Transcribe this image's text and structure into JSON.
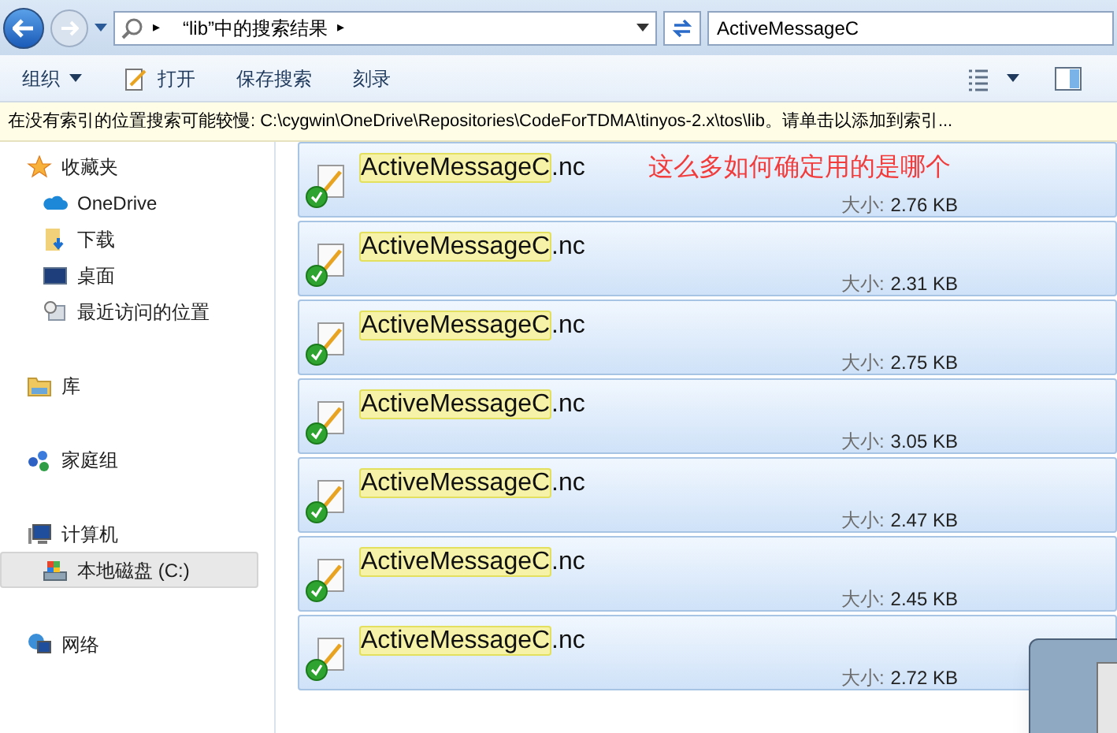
{
  "address": {
    "path": "“lib”中的搜索结果",
    "sep": "▸"
  },
  "search": {
    "value": "ActiveMessageC"
  },
  "toolbar": [
    {
      "label": "组织",
      "kind": "menu"
    },
    {
      "label": "打开",
      "kind": "open"
    },
    {
      "label": "保存搜索",
      "kind": "plain"
    },
    {
      "label": "刻录",
      "kind": "plain"
    }
  ],
  "info_bar": "在没有索引的位置搜索可能较慢: C:\\cygwin\\OneDrive\\Repositories\\CodeForTDMA\\tinyos-2.x\\tos\\lib。请单击以添加到索引...",
  "sidebar": [
    {
      "label": "收藏夹",
      "kind": "star",
      "selected": false,
      "children": [
        {
          "label": "OneDrive",
          "kind": "cloud",
          "selected": false
        },
        {
          "label": "下载",
          "kind": "download",
          "selected": false
        },
        {
          "label": "桌面",
          "kind": "desktop",
          "selected": false
        },
        {
          "label": "最近访问的位置",
          "kind": "recent",
          "selected": false
        }
      ]
    },
    {
      "label": "库",
      "kind": "library",
      "selected": false
    },
    {
      "label": "家庭组",
      "kind": "homegroup",
      "selected": false
    },
    {
      "label": "计算机",
      "kind": "computer",
      "selected": false,
      "children": [
        {
          "label": "本地磁盘 (C:)",
          "kind": "drive",
          "selected": true
        }
      ]
    },
    {
      "label": "网络",
      "kind": "network",
      "selected": false
    }
  ],
  "results": [
    {
      "match": "ActiveMessageC",
      "rest": ".nc",
      "size_label": "大小:",
      "size": "2.76 KB",
      "note": "这么多如何确定用的是哪个"
    },
    {
      "match": "ActiveMessageC",
      "rest": ".nc",
      "size_label": "大小:",
      "size": "2.31 KB"
    },
    {
      "match": "ActiveMessageC",
      "rest": ".nc",
      "size_label": "大小:",
      "size": "2.75 KB"
    },
    {
      "match": "ActiveMessageC",
      "rest": ".nc",
      "size_label": "大小:",
      "size": "3.05 KB"
    },
    {
      "match": "ActiveMessageC",
      "rest": ".nc",
      "size_label": "大小:",
      "size": "2.47 KB"
    },
    {
      "match": "ActiveMessageC",
      "rest": ".nc",
      "size_label": "大小:",
      "size": "2.45 KB"
    },
    {
      "match": "ActiveMessageC",
      "rest": ".nc",
      "size_label": "大小:",
      "size": "2.72 KB"
    }
  ]
}
